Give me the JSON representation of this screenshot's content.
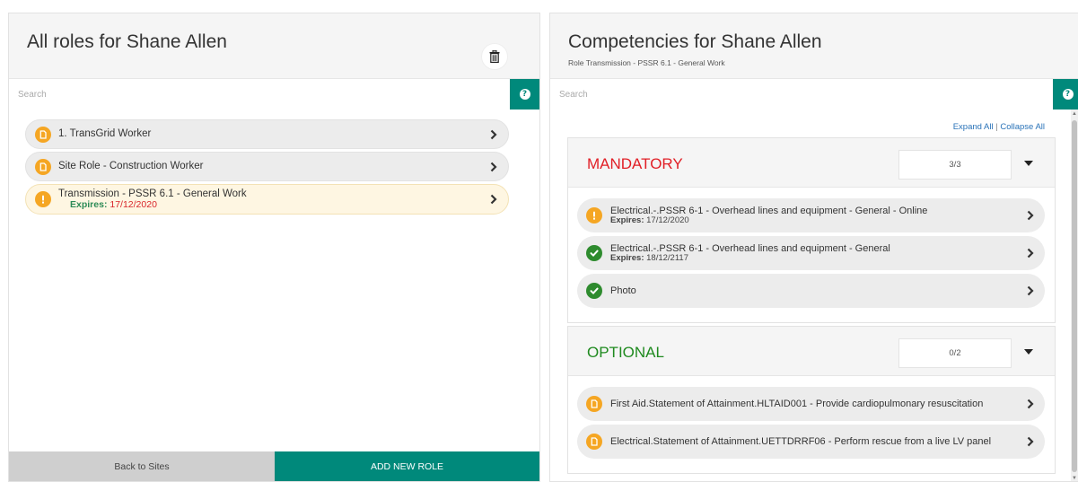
{
  "left": {
    "title": "All roles for Shane Allen",
    "search_placeholder": "Search",
    "roles": [
      {
        "label": "1. TransGrid Worker",
        "status": "pending",
        "expires_label": "",
        "expires_date": ""
      },
      {
        "label": "Site Role - Construction Worker",
        "status": "pending",
        "expires_label": "",
        "expires_date": ""
      },
      {
        "label": "Transmission - PSSR 6.1 - General Work",
        "status": "warning",
        "expires_label": "Expires:",
        "expires_date": "17/12/2020"
      }
    ],
    "back_label": "Back to Sites",
    "add_label": "ADD NEW ROLE"
  },
  "right": {
    "title": "Competencies for Shane Allen",
    "subtitle": "Role Transmission - PSSR 6.1 - General Work",
    "search_placeholder": "Search",
    "expand_all": "Expand All",
    "separator": "|",
    "collapse_all": "Collapse All",
    "sections": [
      {
        "title": "MANDATORY",
        "count": "3/3",
        "items": [
          {
            "label": "Electrical.-.PSSR 6-1 - Overhead lines and equipment - General - Online",
            "status": "warning",
            "expires_label": "Expires:",
            "expires_date": "17/12/2020"
          },
          {
            "label": "Electrical.-.PSSR 6-1 - Overhead lines and equipment - General",
            "status": "complete",
            "expires_label": "Expires:",
            "expires_date": "18/12/2117"
          },
          {
            "label": "Photo",
            "status": "complete",
            "expires_label": "",
            "expires_date": ""
          }
        ]
      },
      {
        "title": "OPTIONAL",
        "count": "0/2",
        "items": [
          {
            "label": "First Aid.Statement of Attainment.HLTAID001 - Provide cardiopulmonary resuscitation",
            "status": "pending",
            "expires_label": "",
            "expires_date": ""
          },
          {
            "label": "Electrical.Statement of Attainment.UETTDRRF06 - Perform rescue from a live LV panel",
            "status": "pending",
            "expires_label": "",
            "expires_date": ""
          }
        ]
      }
    ]
  },
  "colors": {
    "accent": "#00897b",
    "warning": "#f5a623",
    "success": "#2e8b2e",
    "danger": "#e11f26"
  },
  "icons": {
    "trash": "trash-icon",
    "help": "help-icon",
    "chevron": "chevron-right-icon",
    "pending": "document-icon",
    "warning": "exclamation-icon",
    "complete": "check-icon",
    "caret": "caret-down-icon"
  }
}
